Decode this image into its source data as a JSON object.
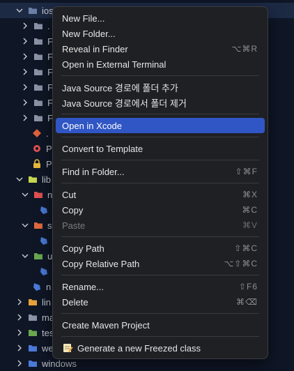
{
  "tree": {
    "rows": [
      {
        "label": "ios",
        "color": "#7aa2f7"
      },
      {
        "label": ".",
        "color": "#8b93a7"
      },
      {
        "label": "F",
        "color": "#8b93a7"
      },
      {
        "label": "F",
        "color": "#8b93a7"
      },
      {
        "label": "F",
        "color": "#8b93a7"
      },
      {
        "label": "F",
        "color": "#8b93a7"
      },
      {
        "label": "F",
        "color": "#8b93a7"
      },
      {
        "label": "F",
        "color": "#8b93a7"
      },
      {
        "label": ".",
        "color": "#e0623b"
      },
      {
        "label": "P",
        "color": "#e05050"
      },
      {
        "label": "P",
        "color": "#e8b93a"
      },
      {
        "label": "lib",
        "color": "#c7d64f"
      },
      {
        "label": "n",
        "color": "#e05050"
      },
      {
        "label": "s",
        "color": "#e06a3c"
      },
      {
        "label": "u",
        "color": "#6aa84f"
      },
      {
        "label": "n",
        "color": "#4a7bd8"
      },
      {
        "label": "lin",
        "color": "#e8a13a"
      },
      {
        "label": "ma",
        "color": "#8b93a7"
      },
      {
        "label": "tes",
        "color": "#6aa84f"
      },
      {
        "label": "we",
        "color": "#4a7bd8"
      },
      {
        "label": "windows",
        "color": "#4a7bd8"
      }
    ]
  },
  "menu": {
    "new_file": "New File...",
    "new_folder": "New Folder...",
    "reveal_in_finder": "Reveal in Finder",
    "reveal_shortcut": "⌥⌘R",
    "open_terminal": "Open in External Terminal",
    "java_add": "Java Source 경로에 폴더 추가",
    "java_remove": "Java Source 경로에서 폴더 제거",
    "open_xcode": "Open in Xcode",
    "convert_template": "Convert to Template",
    "find_in_folder": "Find in Folder...",
    "find_shortcut": "⇧⌘F",
    "cut": "Cut",
    "cut_shortcut": "⌘X",
    "copy": "Copy",
    "copy_shortcut": "⌘C",
    "paste": "Paste",
    "paste_shortcut": "⌘V",
    "copy_path": "Copy Path",
    "copy_path_shortcut": "⇧⌘C",
    "copy_relative_path": "Copy Relative Path",
    "copy_relative_shortcut": "⌥⇧⌘C",
    "rename": "Rename...",
    "rename_shortcut": "⇧F6",
    "delete": "Delete",
    "delete_shortcut": "⌘⌫",
    "create_maven": "Create Maven Project",
    "generate_freezed": "Generate a new Freezed class"
  },
  "colors": {
    "accent": "#2f56c4",
    "menu_bg": "#1f2024",
    "sidebar_bg": "#0f1626"
  }
}
